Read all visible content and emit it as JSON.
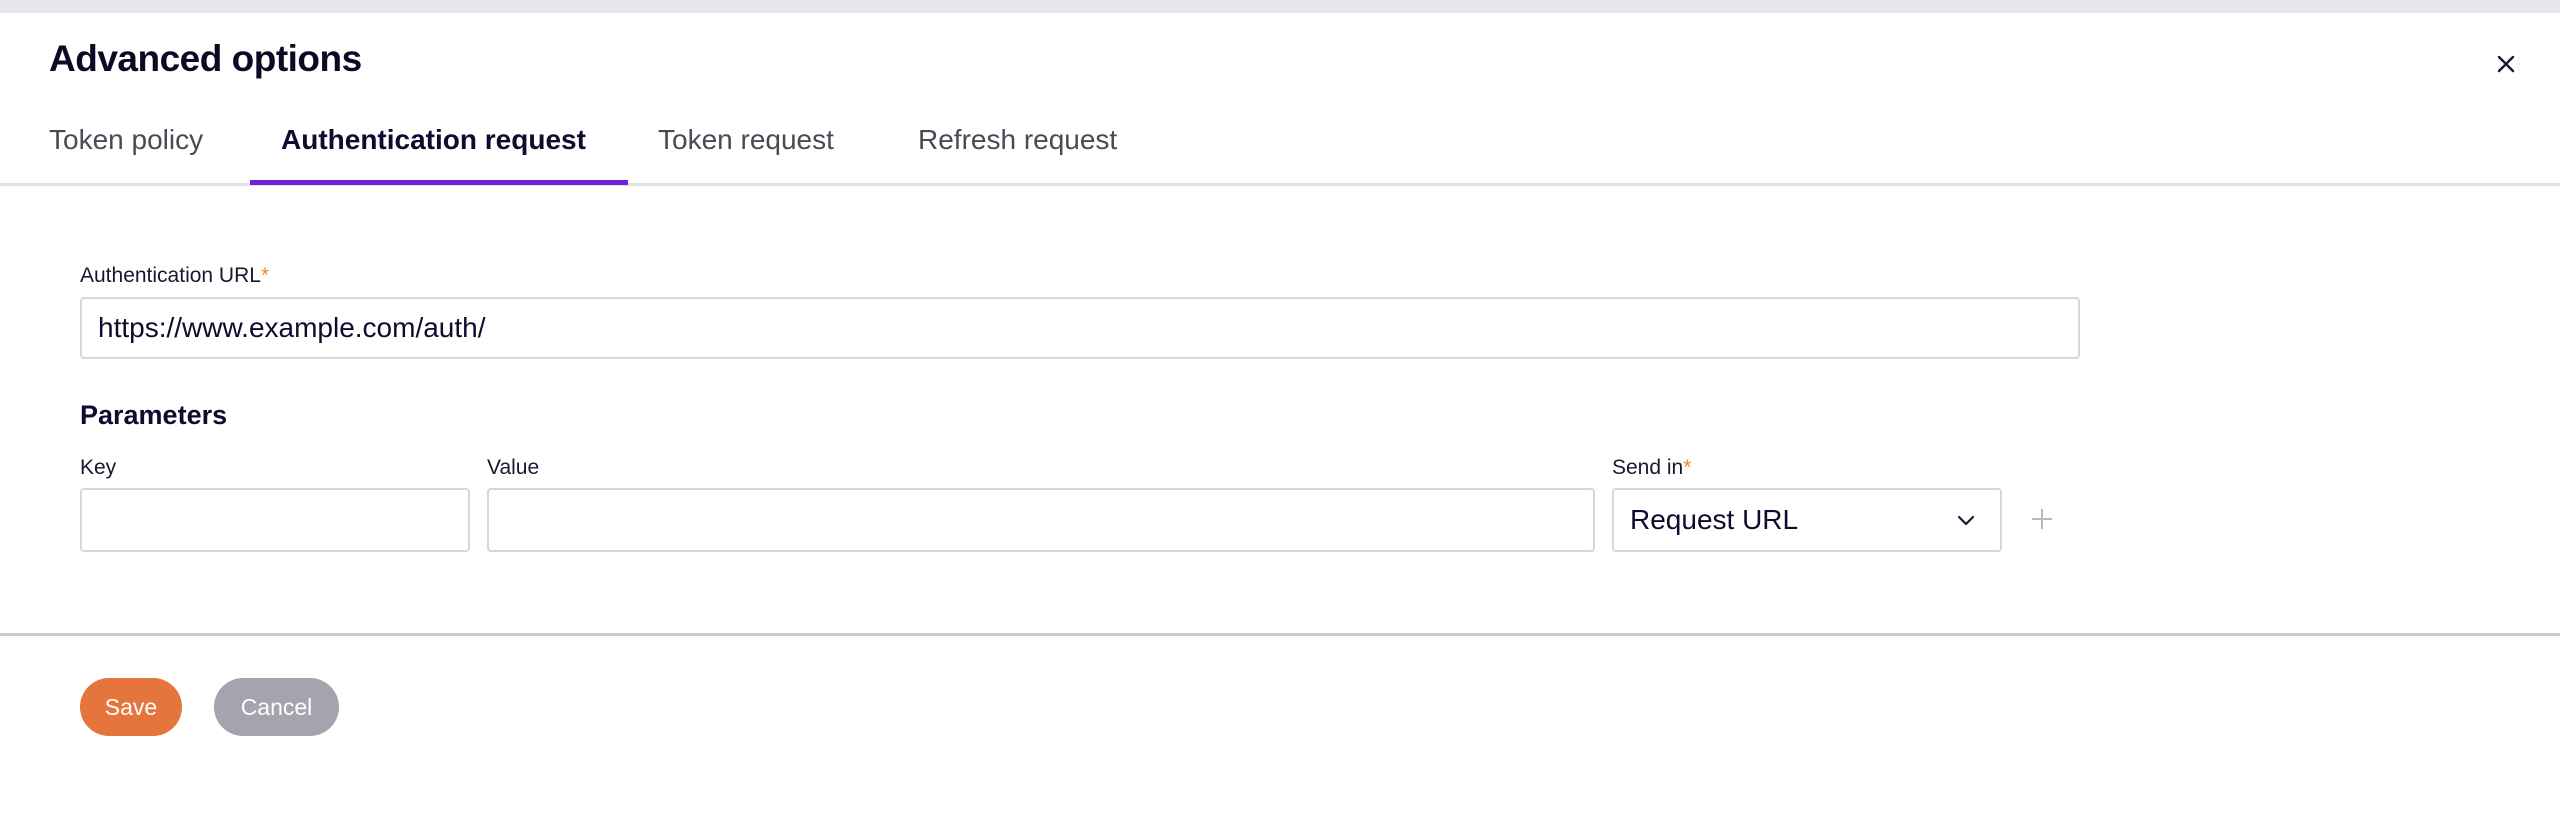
{
  "dialog": {
    "title": "Advanced options",
    "close_icon": "close-icon"
  },
  "tabs": [
    {
      "label": "Token policy",
      "active": false
    },
    {
      "label": "Authentication request",
      "active": true
    },
    {
      "label": "Token request",
      "active": false
    },
    {
      "label": "Refresh request",
      "active": false
    }
  ],
  "form": {
    "auth_url_label": "Authentication URL",
    "required_mark": "*",
    "auth_url_value": "https://www.example.com/auth/",
    "parameters_heading": "Parameters",
    "key_label": "Key",
    "key_value": "",
    "value_label": "Value",
    "value_value": "",
    "send_in_label": "Send in",
    "send_in_selected": "Request URL"
  },
  "footer": {
    "save_label": "Save",
    "cancel_label": "Cancel"
  },
  "colors": {
    "accent": "#6a22d9",
    "save": "#e5753c",
    "cancel": "#a4a4ae",
    "required": "#f08a24"
  }
}
